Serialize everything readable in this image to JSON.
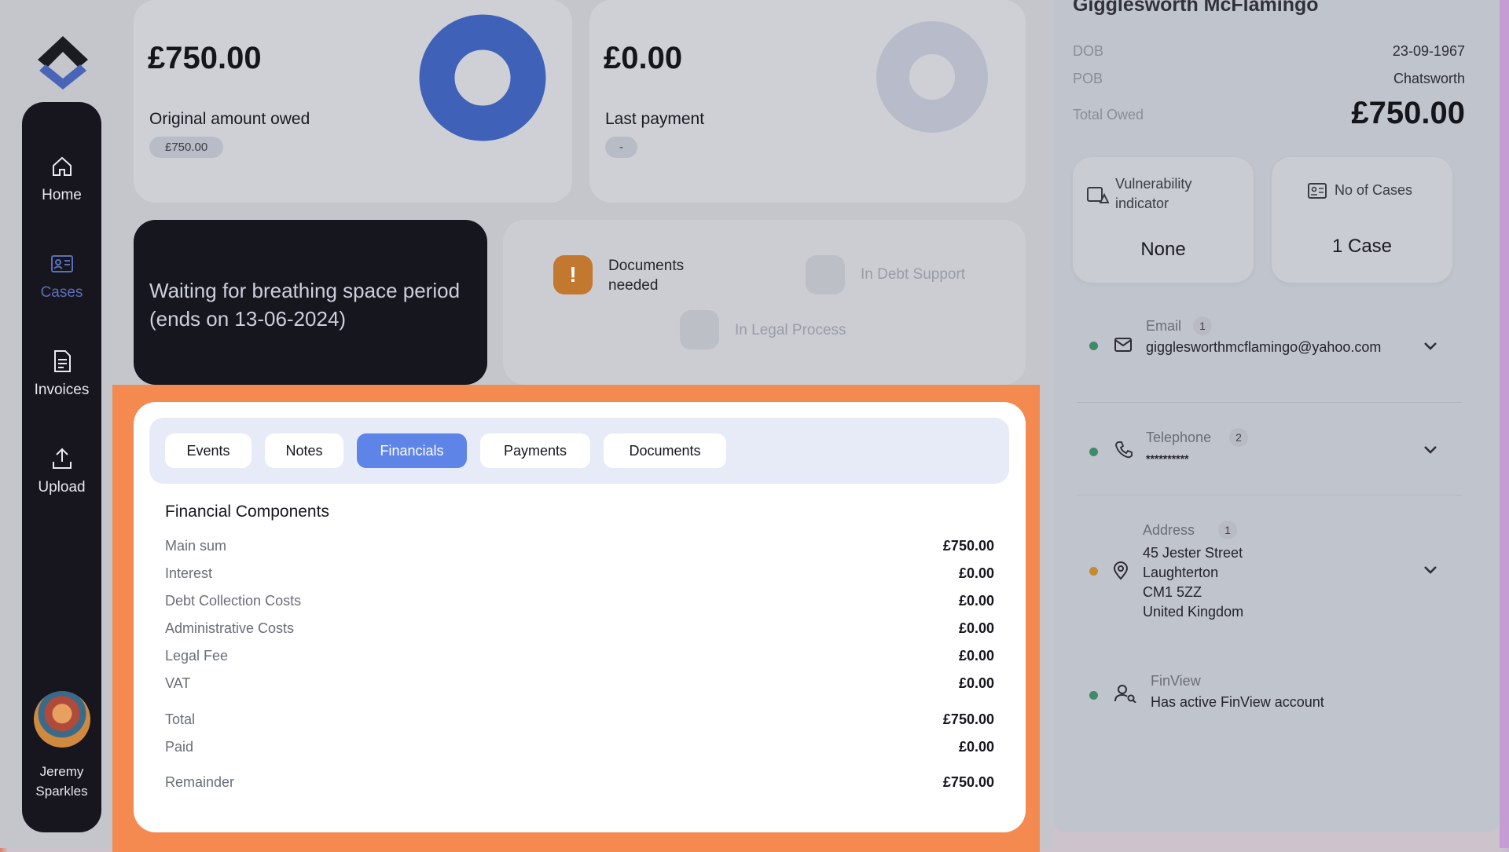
{
  "sidebar": {
    "items": [
      {
        "label": "Home",
        "icon": "home-icon"
      },
      {
        "label": "Cases",
        "icon": "cases-icon"
      },
      {
        "label": "Invoices",
        "icon": "invoice-icon"
      },
      {
        "label": "Upload",
        "icon": "upload-icon"
      }
    ],
    "user_name": "Jeremy Sparkles"
  },
  "cards": {
    "owed": {
      "amount": "£750.00",
      "label": "Original amount owed",
      "pill": "£750.00"
    },
    "collected": {
      "amount": "£0.00",
      "label": "Last payment",
      "pill": "-"
    }
  },
  "breathing": {
    "text": "Waiting for breathing space period (ends on 13-06-2024)"
  },
  "statuses": {
    "documents": "Documents needed",
    "debt_support": "In Debt Support",
    "legal": "In Legal Process",
    "warn_symbol": "!"
  },
  "tabs": [
    "Events",
    "Notes",
    "Financials",
    "Payments",
    "Documents"
  ],
  "active_tab": "Financials",
  "financials": {
    "title": "Financial Components",
    "rows": [
      {
        "label": "Main sum",
        "value": "£750.00"
      },
      {
        "label": "Interest",
        "value": "£0.00"
      },
      {
        "label": "Debt Collection Costs",
        "value": "£0.00"
      },
      {
        "label": "Administrative Costs",
        "value": "£0.00"
      },
      {
        "label": "Legal Fee",
        "value": "£0.00"
      },
      {
        "label": "VAT",
        "value": "£0.00"
      },
      {
        "label": "Total",
        "value": "£750.00"
      },
      {
        "label": "Paid",
        "value": "£0.00"
      },
      {
        "label": "Remainder",
        "value": "£750.00"
      }
    ]
  },
  "person": {
    "name": "Gigglesworth McFlamingo",
    "dob_label": "DOB",
    "dob": "23-09-1967",
    "pob_label": "POB",
    "pob": "Chatsworth",
    "total_owed_label": "Total Owed",
    "total_owed": "£750.00"
  },
  "indicators": {
    "vulnerability_label": "Vulnerability indicator",
    "vulnerability_value": "None",
    "cases_label": "No of Cases",
    "cases_value": "1 Case"
  },
  "contacts": {
    "email": {
      "title": "Email",
      "count": "1",
      "value": "gigglesworthmcflamingo@yahoo.com"
    },
    "telephone": {
      "title": "Telephone",
      "count": "2",
      "value": "**********"
    },
    "address": {
      "title": "Address",
      "count": "1",
      "lines": [
        "45 Jester Street",
        "Laughterton",
        "CM1 5ZZ",
        "United Kingdom"
      ]
    },
    "finview": {
      "title": "FinView",
      "value": "Has active FinView account"
    }
  },
  "colors": {
    "accent": "#5f84e8",
    "highlight": "#f48a4f",
    "donut_owed": "#3f62b8",
    "status_green": "#3f8a6a",
    "status_orange": "#c58a2e"
  }
}
